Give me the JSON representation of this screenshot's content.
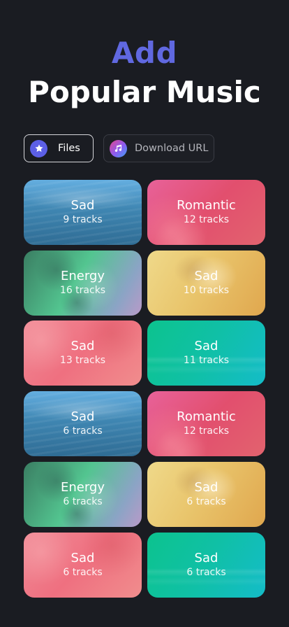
{
  "header": {
    "accent": "Add",
    "title": "Popular Music"
  },
  "tabs": {
    "files": {
      "label": "Files",
      "icon": "star-icon",
      "selected": true
    },
    "url": {
      "label": "Download URL",
      "icon": "music-note-icon",
      "selected": false
    }
  },
  "colors": {
    "background": "#1a1c22",
    "accent": "#6068e0"
  },
  "playlists": [
    {
      "name": "Sad",
      "tracks": "9 tracks",
      "theme": "blue"
    },
    {
      "name": "Romantic",
      "tracks": "12 tracks",
      "theme": "pink"
    },
    {
      "name": "Energy",
      "tracks": "16 tracks",
      "theme": "green"
    },
    {
      "name": "Sad",
      "tracks": "10 tracks",
      "theme": "gold"
    },
    {
      "name": "Sad",
      "tracks": "13 tracks",
      "theme": "coral"
    },
    {
      "name": "Sad",
      "tracks": "11 tracks",
      "theme": "teal"
    },
    {
      "name": "Sad",
      "tracks": "6 tracks",
      "theme": "blue"
    },
    {
      "name": "Romantic",
      "tracks": "12 tracks",
      "theme": "pink"
    },
    {
      "name": "Energy",
      "tracks": "6 tracks",
      "theme": "green"
    },
    {
      "name": "Sad",
      "tracks": "6 tracks",
      "theme": "gold"
    },
    {
      "name": "Sad",
      "tracks": "6 tracks",
      "theme": "coral"
    },
    {
      "name": "Sad",
      "tracks": "6 tracks",
      "theme": "teal"
    }
  ]
}
